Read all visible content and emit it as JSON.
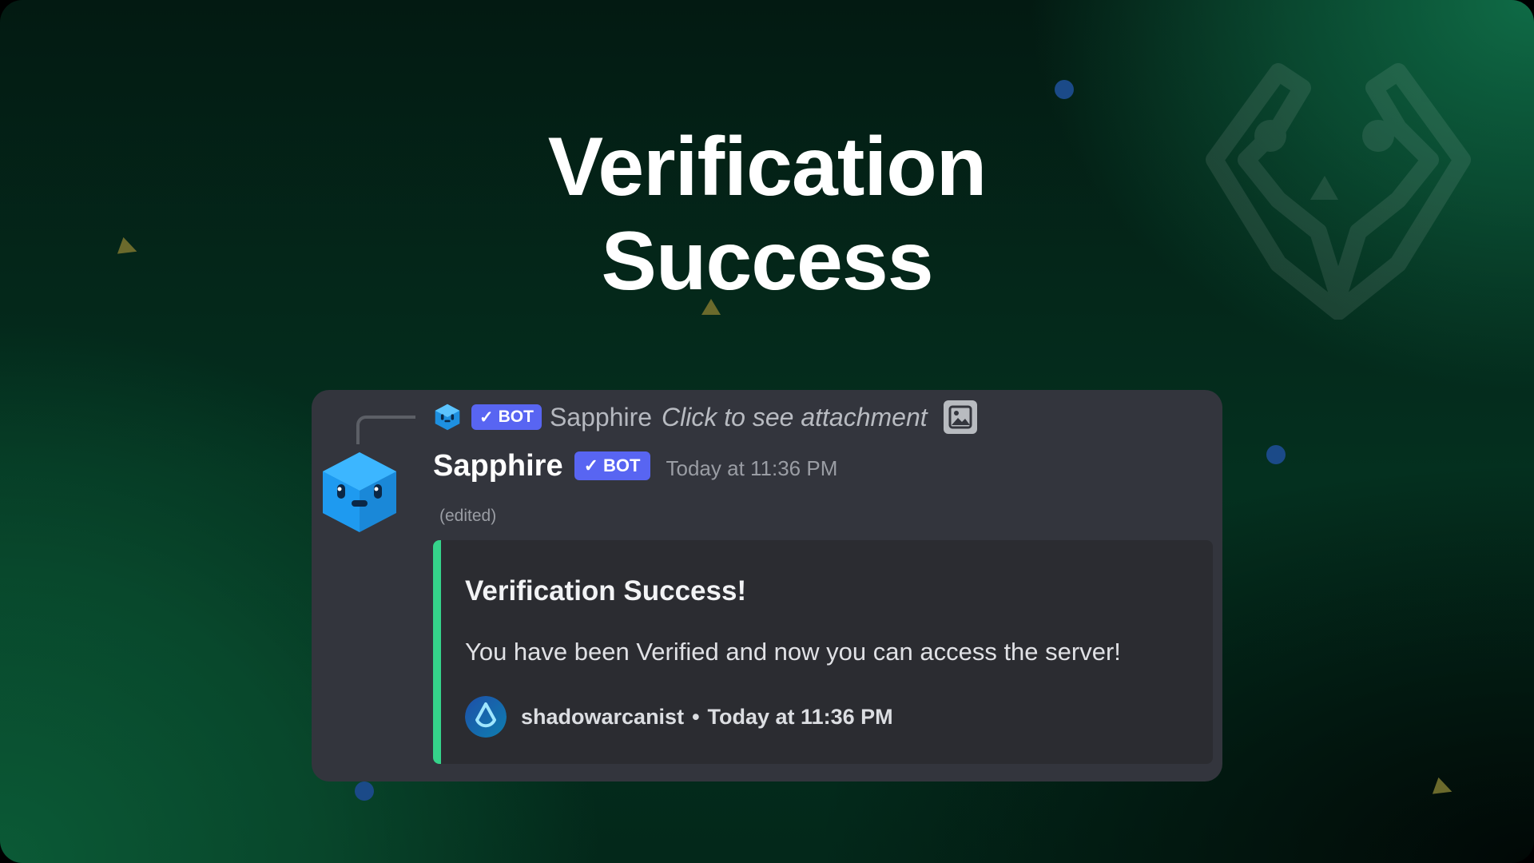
{
  "hero": {
    "line1": "Verification",
    "line2": "Success"
  },
  "reply": {
    "badge": "BOT",
    "name": "Sapphire",
    "text": "Click to see attachment",
    "attachment_icon": "image-icon"
  },
  "message": {
    "author": "Sapphire",
    "badge": "BOT",
    "timestamp": "Today at 11:36 PM",
    "edited": "(edited)"
  },
  "embed": {
    "title": "Verification Success!",
    "description": "You have been Verified and now you can access the server!",
    "footer": {
      "author": "shadowarcanist",
      "separator": "•",
      "timestamp": "Today at 11:36 PM"
    },
    "accent_color": "#35d38a"
  },
  "colors": {
    "card": "#33353d",
    "embed": "#2b2c31",
    "bot_badge": "#5865f2",
    "avatar": "#1ea0f0"
  }
}
